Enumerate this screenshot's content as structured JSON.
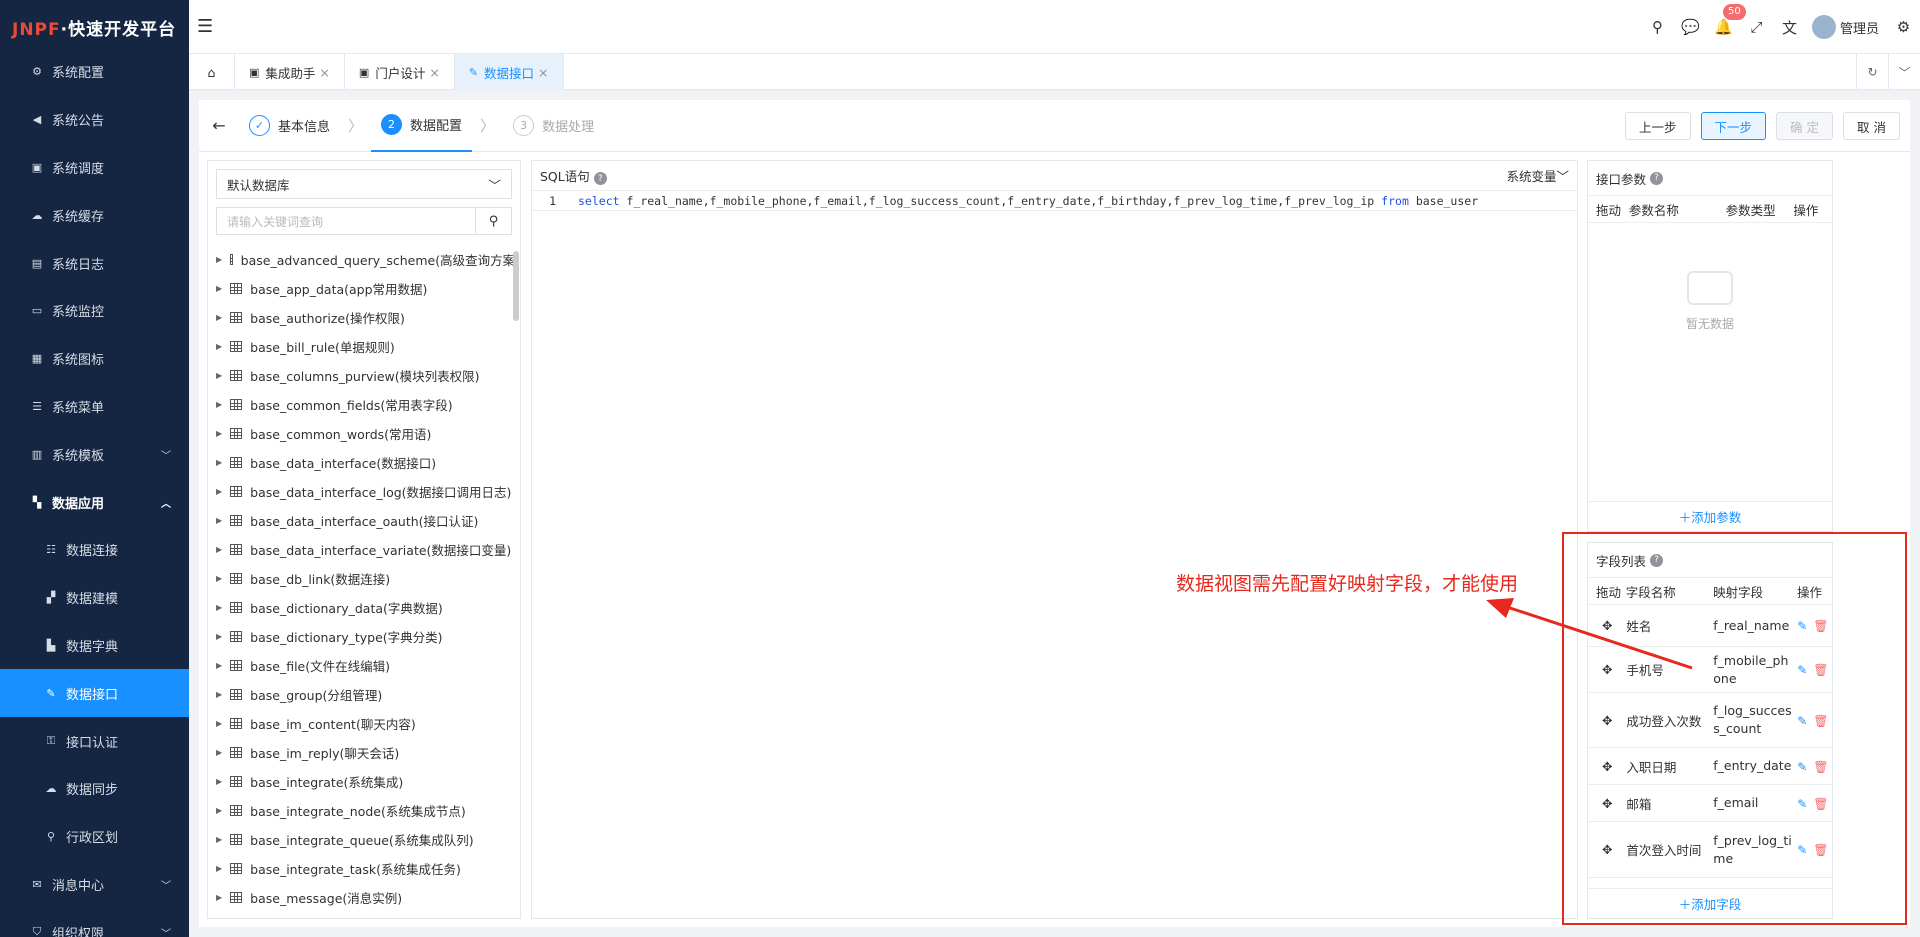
{
  "app": {
    "logo_prefix": "JNPF",
    "logo_title": "·快速开发平台"
  },
  "sidebar": {
    "items": [
      {
        "label": "系统配置",
        "icon": "gear-icon"
      },
      {
        "label": "系统公告",
        "icon": "megaphone-icon"
      },
      {
        "label": "系统调度",
        "icon": "schedule-icon"
      },
      {
        "label": "系统缓存",
        "icon": "cache-icon"
      },
      {
        "label": "系统日志",
        "icon": "log-icon"
      },
      {
        "label": "系统监控",
        "icon": "monitor-icon"
      },
      {
        "label": "系统图标",
        "icon": "image-icon"
      },
      {
        "label": "系统菜单",
        "icon": "menu-icon"
      },
      {
        "label": "系统模板",
        "icon": "template-icon"
      },
      {
        "label": "数据应用",
        "icon": "apps-icon"
      },
      {
        "label": "数据连接",
        "icon": "list-icon"
      },
      {
        "label": "数据建模",
        "icon": "model-icon"
      },
      {
        "label": "数据字典",
        "icon": "book-icon"
      },
      {
        "label": "数据接口",
        "icon": "plug-icon"
      },
      {
        "label": "接口认证",
        "icon": "key-icon"
      },
      {
        "label": "数据同步",
        "icon": "sync-icon"
      },
      {
        "label": "行政区划",
        "icon": "location-icon"
      },
      {
        "label": "消息中心",
        "icon": "message-icon"
      },
      {
        "label": "组织权限",
        "icon": "shield-icon"
      }
    ]
  },
  "header": {
    "notification_count": "50",
    "user_name": "管理员"
  },
  "tabs": [
    {
      "label": "集成助手"
    },
    {
      "label": "门户设计"
    },
    {
      "label": "数据接口"
    }
  ],
  "steps": [
    {
      "num": "1",
      "label": "基本信息"
    },
    {
      "num": "2",
      "label": "数据配置"
    },
    {
      "num": "3",
      "label": "数据处理"
    }
  ],
  "buttons": {
    "prev": "上一步",
    "next": "下一步",
    "confirm": "确 定",
    "cancel": "取 消"
  },
  "left": {
    "db_select": "默认数据库",
    "search_placeholder": "请输入关键词查询",
    "tables": [
      "base_advanced_query_scheme(高级查询方案)",
      "base_app_data(app常用数据)",
      "base_authorize(操作权限)",
      "base_bill_rule(单据规则)",
      "base_columns_purview(模块列表权限)",
      "base_common_fields(常用表字段)",
      "base_common_words(常用语)",
      "base_data_interface(数据接口)",
      "base_data_interface_log(数据接口调用日志)",
      "base_data_interface_oauth(接口认证)",
      "base_data_interface_variate(数据接口变量)",
      "base_db_link(数据连接)",
      "base_dictionary_data(字典数据)",
      "base_dictionary_type(字典分类)",
      "base_file(文件在线编辑)",
      "base_group(分组管理)",
      "base_im_content(聊天内容)",
      "base_im_reply(聊天会话)",
      "base_integrate(系统集成)",
      "base_integrate_node(系统集成节点)",
      "base_integrate_queue(系统集成队列)",
      "base_integrate_task(系统集成任务)",
      "base_message(消息实例)"
    ]
  },
  "sql": {
    "title": "SQL语句",
    "sys_var": "系统变量",
    "line_no": "1",
    "kw_select": "select",
    "columns": "f_real_name,f_mobile_phone,f_email,f_log_success_count,f_entry_date,f_birthday,f_prev_log_time,f_prev_log_ip",
    "kw_from": "from",
    "table": "base_user"
  },
  "params": {
    "title": "接口参数",
    "cols": [
      "拖动",
      "参数名称",
      "参数类型",
      "操作"
    ],
    "empty": "暂无数据",
    "add": "添加参数"
  },
  "fields": {
    "title": "字段列表",
    "cols": [
      "拖动",
      "字段名称",
      "映射字段",
      "操作"
    ],
    "rows": [
      {
        "name": "姓名",
        "map": "f_real_name"
      },
      {
        "name": "手机号",
        "map": "f_mobile_phone"
      },
      {
        "name": "成功登入次数",
        "map": "f_log_success_count"
      },
      {
        "name": "入职日期",
        "map": "f_entry_date"
      },
      {
        "name": "邮箱",
        "map": "f_email"
      },
      {
        "name": "首次登入时间",
        "map": "f_prev_log_time"
      }
    ],
    "add": "添加字段"
  },
  "annotation": "数据视图需先配置好映射字段，才能使用",
  "colors": {
    "accent": "#1890ff",
    "sidebar_bg": "#152642",
    "annotation": "#e8281c"
  }
}
